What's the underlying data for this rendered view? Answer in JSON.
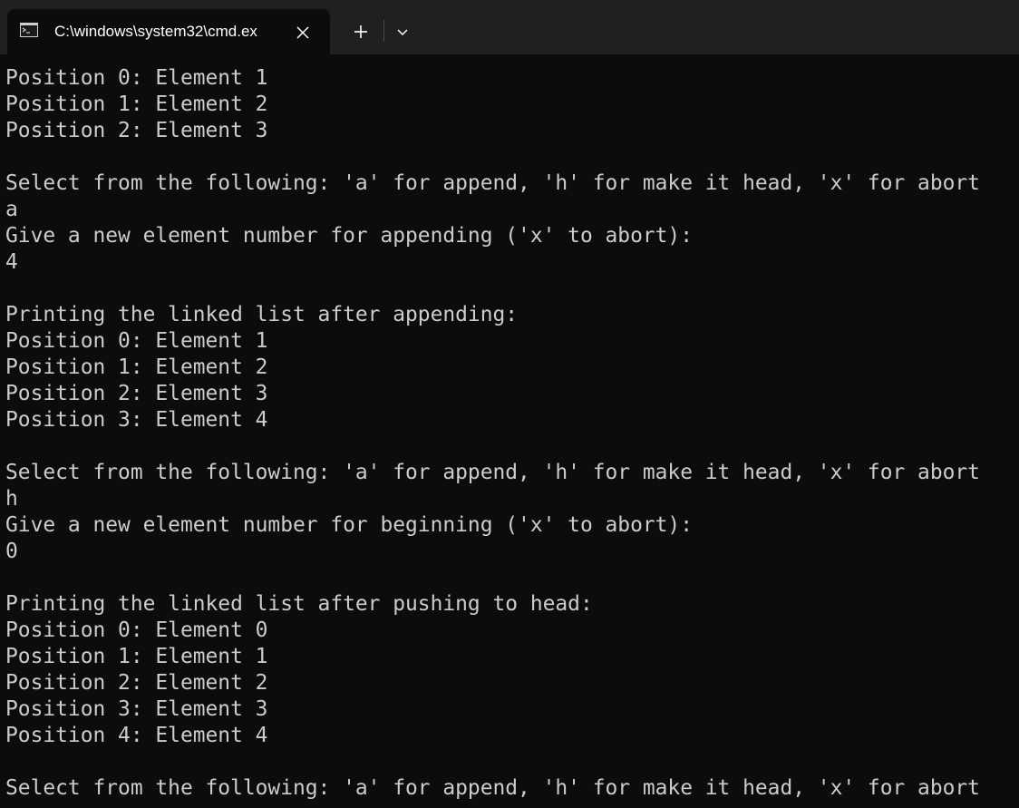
{
  "window": {
    "tab_title": "C:\\windows\\system32\\cmd.ex",
    "tab_icon": "cmd-terminal-icon",
    "close_icon": "close-icon",
    "new_tab_icon": "plus-icon",
    "dropdown_icon": "chevron-down-icon"
  },
  "colors": {
    "background": "#0c0c0c",
    "titlebar": "#202020",
    "text": "#cccccc"
  },
  "console": {
    "lines": [
      "Position 0: Element 1",
      "Position 1: Element 2",
      "Position 2: Element 3",
      "",
      "Select from the following: 'a' for append, 'h' for make it head, 'x' for abort",
      "a",
      "Give a new element number for appending ('x' to abort):",
      "4",
      "",
      "Printing the linked list after appending:",
      "Position 0: Element 1",
      "Position 1: Element 2",
      "Position 2: Element 3",
      "Position 3: Element 4",
      "",
      "Select from the following: 'a' for append, 'h' for make it head, 'x' for abort",
      "h",
      "Give a new element number for beginning ('x' to abort):",
      "0",
      "",
      "Printing the linked list after pushing to head:",
      "Position 0: Element 0",
      "Position 1: Element 1",
      "Position 2: Element 2",
      "Position 3: Element 3",
      "Position 4: Element 4",
      "",
      "Select from the following: 'a' for append, 'h' for make it head, 'x' for abort"
    ]
  }
}
